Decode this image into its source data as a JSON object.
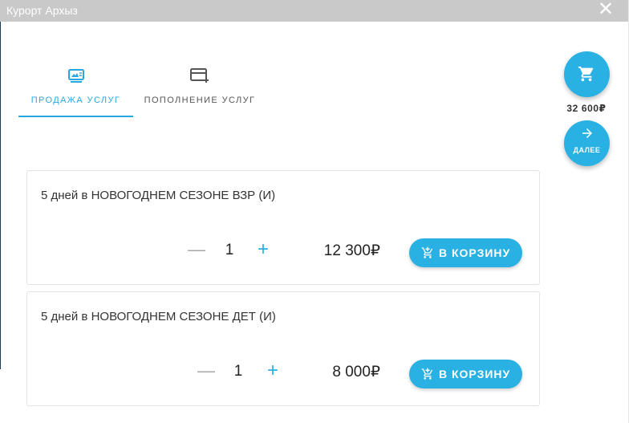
{
  "window": {
    "title": "Курорт Архыз",
    "close_symbol": "✕"
  },
  "tabs": [
    {
      "label": "ПРОДАЖА УСЛУГ",
      "icon": "ticket-icon",
      "active": true
    },
    {
      "label": "ПОПОЛНЕНИЕ УСЛУГ",
      "icon": "card-add-icon",
      "active": false
    }
  ],
  "cart": {
    "icon": "cart-icon",
    "total": "32 600₽"
  },
  "next": {
    "icon": "arrow-right-icon",
    "label": "ДАЛЕЕ"
  },
  "products": [
    {
      "title": "5 дней в НОВОГОДНЕМ СЕЗОНЕ ВЗР (И)",
      "minus": "—",
      "quantity": "1",
      "plus": "+",
      "price": "12 300₽",
      "button_label": "В КОРЗИНУ"
    },
    {
      "title": "5 дней в НОВОГОДНЕМ СЕЗОНЕ ДЕТ (И)",
      "minus": "—",
      "quantity": "1",
      "plus": "+",
      "price": "8 000₽",
      "button_label": "В КОРЗИНУ"
    }
  ],
  "colors": {
    "accent": "#2ab1e3",
    "titlebar": "#c9c9c9",
    "muted": "#a6a6a6"
  }
}
